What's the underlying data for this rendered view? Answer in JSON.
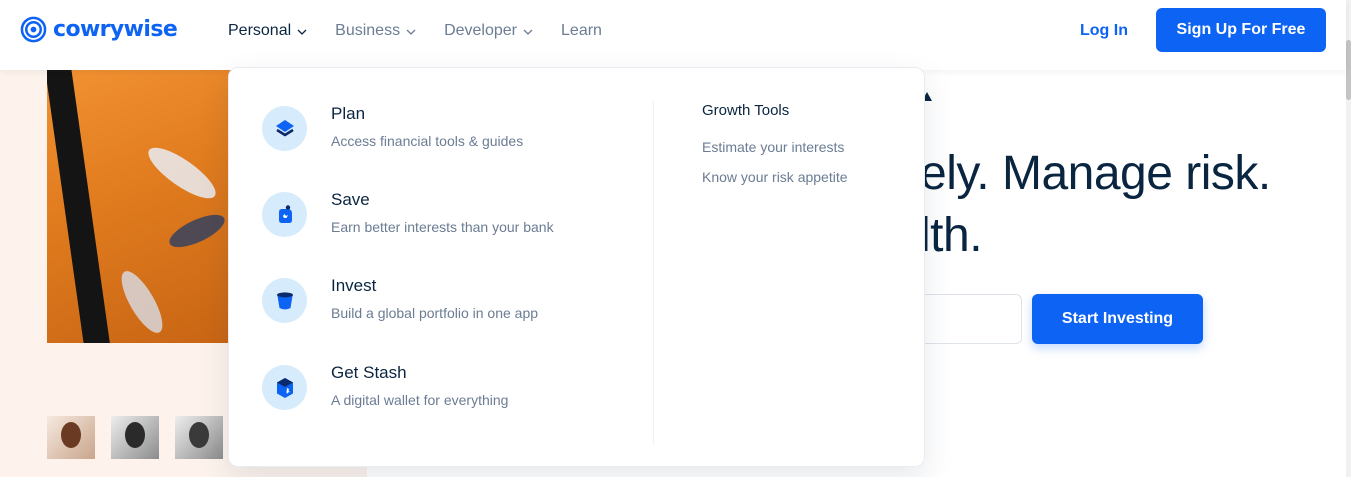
{
  "brand": {
    "name": "cowrywise",
    "color": "#0d63f3"
  },
  "nav": {
    "items": [
      {
        "label": "Personal",
        "has_dropdown": true,
        "active": true
      },
      {
        "label": "Business",
        "has_dropdown": true,
        "active": false
      },
      {
        "label": "Developer",
        "has_dropdown": true,
        "active": false
      },
      {
        "label": "Learn",
        "has_dropdown": false,
        "active": false
      }
    ],
    "login_label": "Log In",
    "signup_label": "Sign Up For Free"
  },
  "dropdown": {
    "items": [
      {
        "title": "Plan",
        "description": "Access financial tools & guides",
        "icon": "layers-icon"
      },
      {
        "title": "Save",
        "description": "Earn better interests than your bank",
        "icon": "piggy-bank-icon"
      },
      {
        "title": "Invest",
        "description": "Build a global portfolio in one app",
        "icon": "bucket-icon"
      },
      {
        "title": "Get Stash",
        "description": "A digital wallet for everything",
        "icon": "wallet-box-icon"
      }
    ],
    "growth_tools": {
      "heading": "Growth Tools",
      "links": [
        "Estimate your interests",
        "Know your risk appetite"
      ]
    }
  },
  "hero": {
    "heading_line1": "ely. Manage risk.",
    "heading_line2": "lth.",
    "cta_label": "Start Investing"
  },
  "colors": {
    "primary": "#0d63f3",
    "text_dark": "#0a2540",
    "text_muted": "#6b7c93",
    "icon_bg": "#d6ebfb",
    "hero_left_bg": "#fdf3ec"
  }
}
